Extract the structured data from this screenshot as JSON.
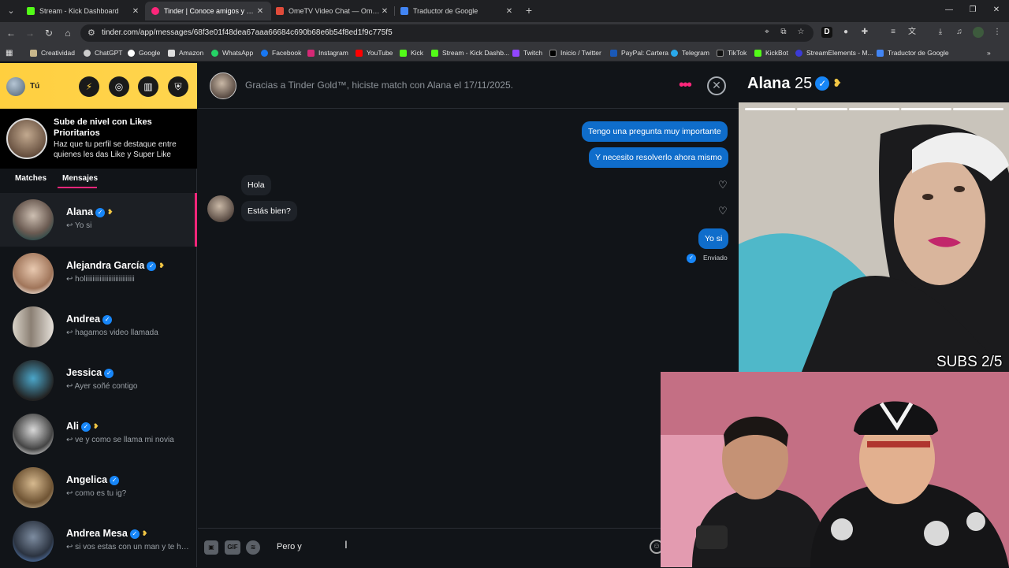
{
  "browser": {
    "tabs": [
      {
        "title": "Stream - Kick Dashboard",
        "color": "#53fc18"
      },
      {
        "title": "Tinder | Conoce amigos y gente",
        "color": "#fd267a"
      },
      {
        "title": "OmeTV Video Chat — Omegle",
        "color": "#e04b3a"
      },
      {
        "title": "Traductor de Google",
        "color": "#4285f4"
      }
    ],
    "url": "tinder.com/app/messages/68f3e01f48dea67aaa66684c690b68e6b54f8ed1f9c775f5",
    "bookmarks": [
      "Creatividad",
      "ChatGPT",
      "Google",
      "Amazon",
      "WhatsApp",
      "Facebook",
      "Instagram",
      "YouTube",
      "Kick",
      "Stream - Kick Dashb...",
      "Twitch",
      "Inicio / Twitter",
      "PayPal: Cartera",
      "Telegram",
      "TikTok",
      "KickBot",
      "StreamElements - M...",
      "Traductor de Google"
    ]
  },
  "sidebar": {
    "me_label": "Tú",
    "promo": {
      "title": "Sube de nivel con Likes Prioritarios",
      "subtitle": "Haz que tu perfil se destaque entre quienes les das Like y Super Like"
    },
    "tabs": {
      "matches": "Matches",
      "messages": "Mensajes"
    },
    "conversations": [
      {
        "name": "Alana",
        "preview": "Yo si"
      },
      {
        "name": "Alejandra García",
        "preview": "holiiiiiiiiiiiiiiiiiiiiiiiiiiii"
      },
      {
        "name": "Andrea",
        "preview": "hagamos video llamada"
      },
      {
        "name": "Jessica",
        "preview": "Ayer soñé contigo"
      },
      {
        "name": "Ali",
        "preview": "ve y como se llama mi novia"
      },
      {
        "name": "Angelica",
        "preview": "como es tu ig?"
      },
      {
        "name": "Andrea Mesa",
        "preview": "si vos estas con un man y te hablo"
      }
    ]
  },
  "chat": {
    "header_text": "Gracias a Tinder Gold™, hiciste match con Alana el 17/11/2025.",
    "messages": {
      "out1": "Tengo una pregunta muy importante",
      "out2": "Y necesito resolverlo ahora mismo",
      "in1": "Hola",
      "in2": "Estás bien?",
      "out3": "Yo si"
    },
    "sent_status": "Enviado",
    "composer_text": "Pero y",
    "gif_label": "GIF"
  },
  "profile": {
    "name": "Alana",
    "age": "25",
    "overlay": "SUBS 2/5"
  },
  "colors": {
    "brand": "#fd267a",
    "outgoing_bubble": "#0f6dcb",
    "verified": "#1786f8",
    "gold": "#ffd54f"
  }
}
